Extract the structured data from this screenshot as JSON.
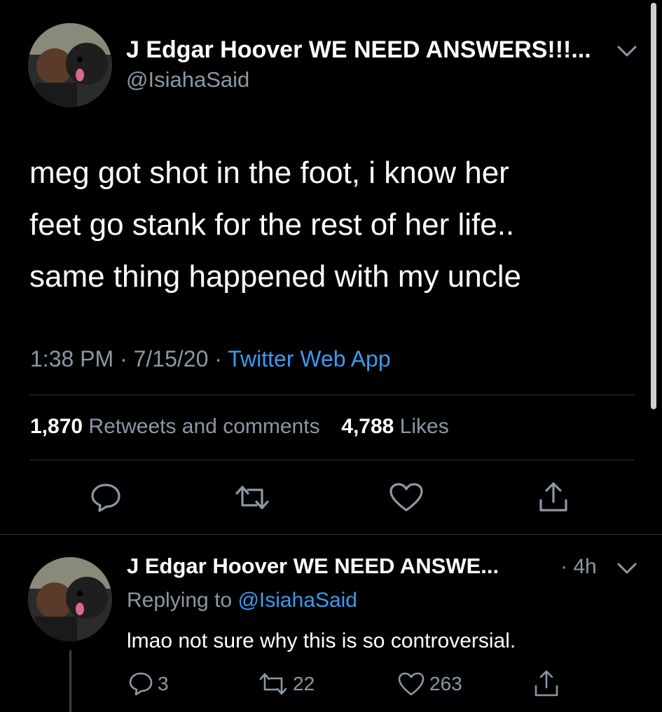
{
  "main_tweet": {
    "display_name": "J Edgar Hoover WE NEED ANSWERS!!!...",
    "handle": "@IsiahaSaid",
    "text_lines": [
      "meg got shot in the foot, i know her",
      "feet go stank for the rest of her life..",
      "same thing happened with my uncle"
    ],
    "time": "1:38 PM",
    "sep1": "·",
    "date": "7/15/20",
    "sep2": "·",
    "source": "Twitter Web App",
    "retweets_count": "1,870",
    "retweets_label": "Retweets and comments",
    "likes_count": "4,788",
    "likes_label": "Likes",
    "icons": [
      "reply-icon",
      "retweet-icon",
      "like-icon",
      "share-icon"
    ]
  },
  "reply_tweet": {
    "display_name": "J Edgar Hoover WE NEED ANSWE...",
    "time_ago": "· 4h",
    "replying_to_label": "Replying to",
    "replying_to_handle": "@IsiahaSaid",
    "text": "lmao not sure why this is so controversial.",
    "reply_count": "3",
    "retweet_count": "22",
    "like_count": "263"
  },
  "colors": {
    "background": "#000000",
    "muted": "#8b98a5",
    "link": "#3b9bf0",
    "divider": "#2f3336"
  }
}
